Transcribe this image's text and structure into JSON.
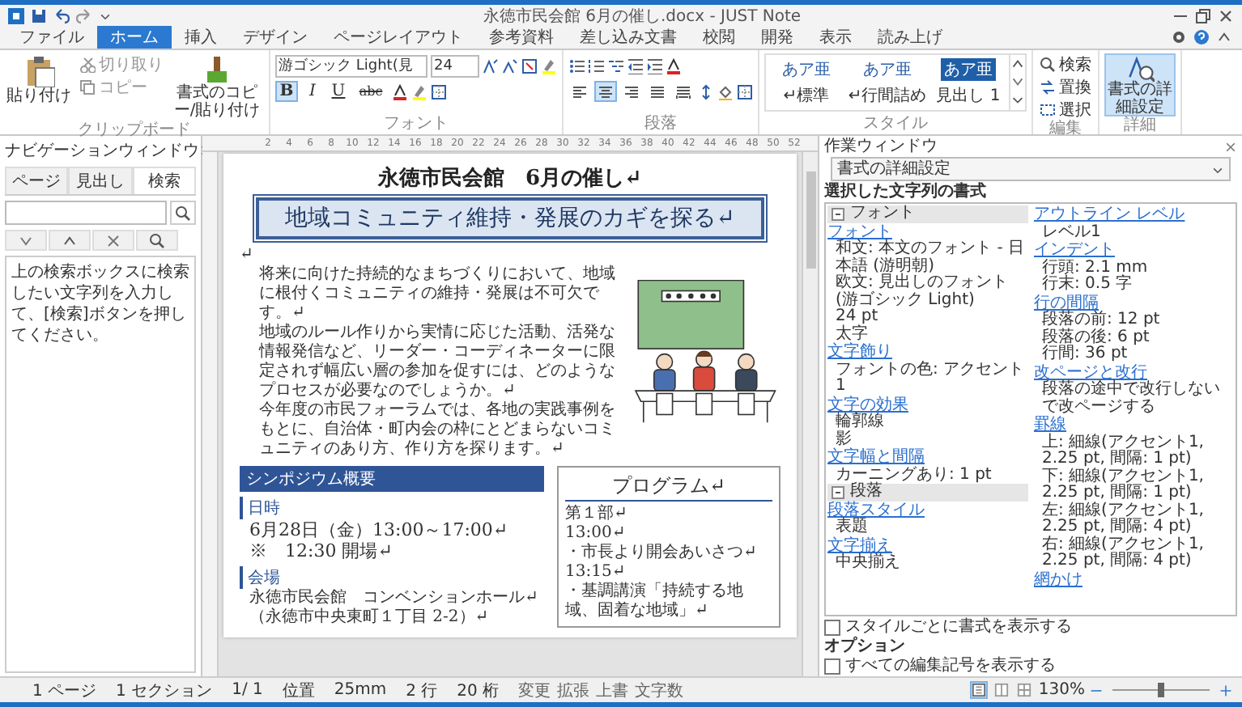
{
  "window": {
    "title": "永徳市民会館 6月の催し.docx - JUST Note"
  },
  "tabs": [
    {
      "label": "ファイル",
      "selected": false
    },
    {
      "label": "ホーム",
      "selected": true
    },
    {
      "label": "挿入",
      "selected": false
    },
    {
      "label": "デザイン",
      "selected": false
    },
    {
      "label": "ページレイアウト",
      "selected": false
    },
    {
      "label": "参考資料",
      "selected": false
    },
    {
      "label": "差し込み文書",
      "selected": false
    },
    {
      "label": "校閲",
      "selected": false
    },
    {
      "label": "開発",
      "selected": false
    },
    {
      "label": "表示",
      "selected": false
    },
    {
      "label": "読み上げ",
      "selected": false
    }
  ],
  "ribbon": {
    "clipboard": {
      "label": "クリップボード",
      "paste": "貼り付け",
      "cut": "切り取り",
      "copy": "コピー",
      "format_painter": "書式のコピー/貼り付け"
    },
    "font": {
      "label": "フォント",
      "font_name": "游ゴシック Light(見",
      "font_size": "24",
      "toggles": [
        {
          "kind": "bold",
          "label": "B",
          "selected": true
        },
        {
          "kind": "italic",
          "label": "I",
          "selected": false
        },
        {
          "kind": "underline",
          "label": "U",
          "selected": false
        },
        {
          "kind": "strike",
          "label": "abc",
          "selected": false
        }
      ]
    },
    "paragraph": {
      "label": "段落",
      "alignments": [
        {
          "kind": "left",
          "selected": false
        },
        {
          "kind": "center",
          "selected": true
        },
        {
          "kind": "right",
          "selected": false
        },
        {
          "kind": "justify",
          "selected": false
        },
        {
          "kind": "distributed",
          "selected": false
        }
      ]
    },
    "styles": {
      "label": "スタイル",
      "items": [
        {
          "sample": "あア亜",
          "name": "↵標準",
          "selected": false
        },
        {
          "sample": "あア亜",
          "name": "↵行間詰め",
          "selected": false
        },
        {
          "sample": "あア亜",
          "name": "見出し 1",
          "selected": true
        }
      ]
    },
    "editing": {
      "label": "編集",
      "items": [
        "検索",
        "置換",
        "選択"
      ]
    },
    "details": {
      "label": "詳細",
      "button": "書式の詳細設定",
      "selected": true
    }
  },
  "ruler": {
    "numbers": [
      "2",
      "4",
      "6",
      "8",
      "10",
      "12",
      "14",
      "16",
      "18",
      "20",
      "22",
      "24",
      "26",
      "28",
      "30",
      "32",
      "34",
      "36",
      "38",
      "40",
      "42",
      "44",
      "46",
      "48",
      "50",
      "52"
    ]
  },
  "navigation": {
    "title": "ナビゲーションウィンドウ",
    "tabs": [
      {
        "label": "ページ",
        "selected": false
      },
      {
        "label": "見出し",
        "selected": false
      },
      {
        "label": "検索",
        "selected": true
      }
    ],
    "message": "上の検索ボックスに検索したい文字列を入力して、[検索]ボタンを押してください。"
  },
  "document": {
    "title": "永徳市民会館　6月の催し↵",
    "heading": "地域コミュニティ維持・発展のカギを探る↵",
    "paragraphs": [
      "↵",
      "将来に向けた持続的なまちづくりにおいて、地域に根付くコミュニティの維持・発展は不可欠です。↵",
      "地域のルール作りから実情に応じた活動、活発な情報発信など、リーダー・コーディネーターに限定されず幅広い層の参加を促すには、どのようなプロセスが必要なのでしょうか。↵",
      "今年度の市民フォーラムでは、各地の実践事例をもとに、自治体・町内会の枠にとどまらないコミュニティのあり方、作り方を探ります。↵"
    ],
    "section_bar": "シンポジウム概要",
    "items": [
      {
        "kind": "label",
        "text": "日時"
      },
      {
        "kind": "large",
        "text": "6月28日（金）13:00～17:00↵"
      },
      {
        "kind": "large",
        "text": "※　12:30 開場↵"
      },
      {
        "kind": "label",
        "text": "会場"
      },
      {
        "kind": "body",
        "text": "永徳市民会館　コンベンションホール↵"
      },
      {
        "kind": "body",
        "text": "（永徳市中央東町１丁目 2-2）↵"
      }
    ],
    "program": {
      "title": "プログラム↵",
      "lines": [
        "第１部↵",
        "13:00↵",
        "・市長より開会あいさつ↵",
        "13:15↵",
        "・基調講演「持続する地域、固着な地域」↵"
      ]
    }
  },
  "task_pane": {
    "title": "作業ウィンドウ",
    "dropdown": "書式の詳細設定",
    "caption": "選択した文字列の書式",
    "sections": [
      {
        "title": "フォント",
        "groups": [
          {
            "link": "フォント",
            "lines": [
              "和文: 本文のフォント - 日本語 (游明朝)",
              "欧文: 見出しのフォント (游ゴシック Light)",
              "24 pt",
              "太字"
            ]
          },
          {
            "link": "文字飾り",
            "lines": [
              "フォントの色: アクセント1"
            ]
          },
          {
            "link": "文字の効果",
            "lines": [
              "輪郭線",
              "影"
            ]
          },
          {
            "link": "文字幅と間隔",
            "lines": [
              "カーニングあり: 1 pt"
            ]
          }
        ]
      },
      {
        "title": "段落",
        "groups": [
          {
            "link": "段落スタイル",
            "lines": [
              "表題"
            ]
          },
          {
            "link": "文字揃え",
            "lines": [
              "中央揃え"
            ]
          },
          {
            "link": "アウトライン レベル",
            "lines": [
              "レベル1"
            ]
          },
          {
            "link": "インデント",
            "lines": [
              "行頭: 2.1 mm",
              "行末: 0.5 字"
            ]
          },
          {
            "link": "行の間隔",
            "lines": [
              "段落の前: 12 pt",
              "段落の後: 6 pt",
              "行間: 36 pt"
            ]
          },
          {
            "link": "改ページと改行",
            "lines": [
              "段落の途中で改行しないで改ページする"
            ]
          },
          {
            "link": "罫線",
            "lines": [
              "上: 細線(アクセント1, 2.25 pt, 間隔: 1 pt)",
              "下: 細線(アクセント1, 2.25 pt, 間隔: 1 pt)",
              "左: 細線(アクセント1, 2.25 pt, 間隔: 4 pt)",
              "右: 細線(アクセント1, 2.25 pt, 間隔: 4 pt)"
            ]
          },
          {
            "link": "網かけ"
          }
        ]
      }
    ],
    "checkbox": {
      "label": "スタイルごとに書式を表示する",
      "checked": false
    },
    "options_label": "オプション",
    "options": [
      {
        "label": "すべての編集記号を表示する",
        "checked": false
      }
    ]
  },
  "status_bar": {
    "items": [
      "1 ページ",
      "1 セクション",
      "1/ 1",
      "位置",
      "25mm",
      "2 行",
      "20 桁"
    ],
    "modes": [
      "変更",
      "拡張",
      "上書",
      "文字数"
    ],
    "views": [
      {
        "selected": true
      },
      {
        "selected": false
      },
      {
        "selected": false
      }
    ],
    "zoom": "130%",
    "zoom_slider": {
      "level": 0.5
    }
  }
}
